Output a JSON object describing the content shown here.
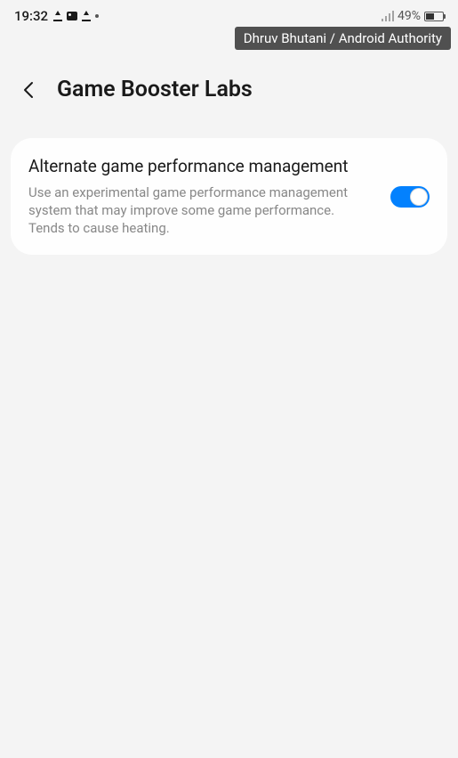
{
  "status_bar": {
    "time": "19:32",
    "battery_percent": "49%"
  },
  "watermark": "Dhruv Bhutani / Android Authority",
  "header": {
    "title": "Game Booster Labs"
  },
  "setting": {
    "title": "Alternate game performance management",
    "description": "Use an experimental game performance management system that may improve some game performance. Tends to cause heating.",
    "enabled": true
  }
}
